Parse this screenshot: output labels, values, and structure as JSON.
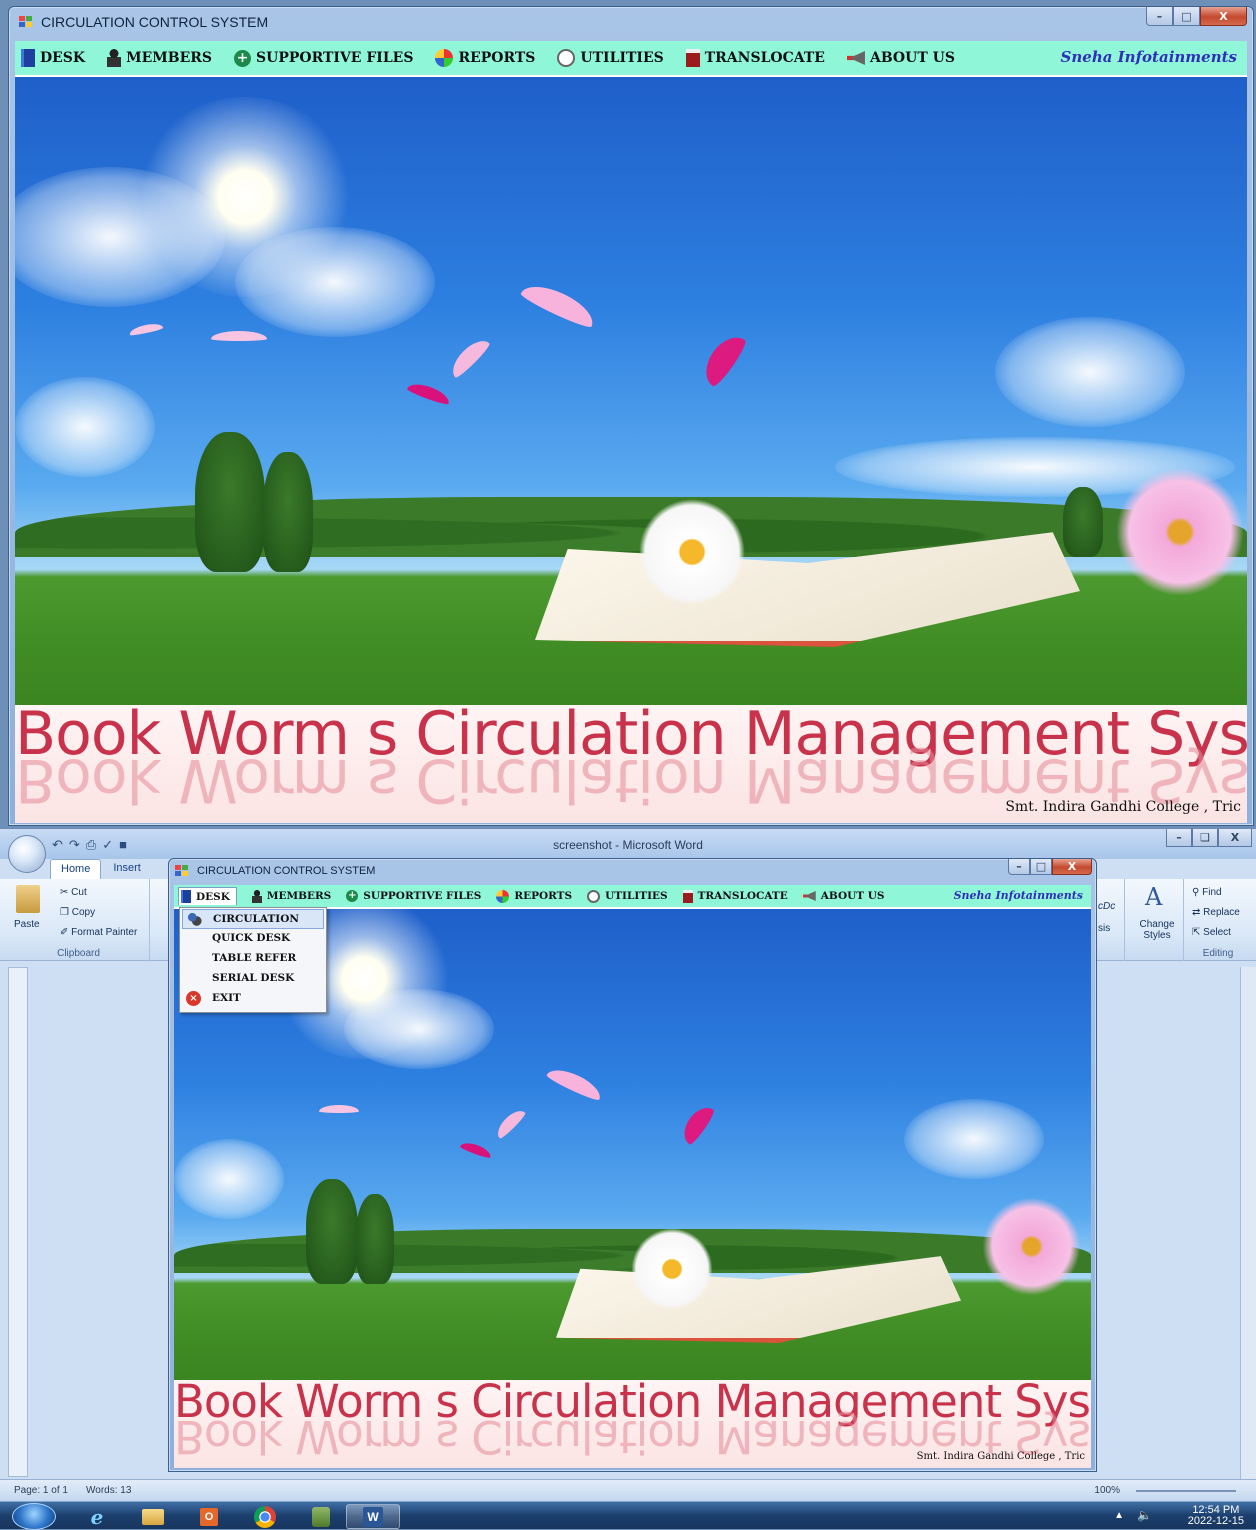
{
  "app_window": {
    "title": "CIRCULATION CONTROL SYSTEM",
    "controls": {
      "minimize": "–",
      "maximize": "□",
      "close": "X"
    },
    "menu": [
      {
        "key": "desk",
        "label": "DESK"
      },
      {
        "key": "members",
        "label": "MEMBERS"
      },
      {
        "key": "supportive",
        "label": "SUPPORTIVE FILES"
      },
      {
        "key": "reports",
        "label": "REPORTS"
      },
      {
        "key": "utilities",
        "label": "UTILITIES"
      },
      {
        "key": "translocate",
        "label": "TRANSLOCATE"
      },
      {
        "key": "about",
        "label": "ABOUT US"
      }
    ],
    "brand": "Sneha Infotainments",
    "banner_title": "Book Worm s Circulation Management System",
    "college": "Smt. Indira Gandhi College , Tric"
  },
  "word_window": {
    "title": "screenshot - Microsoft Word",
    "tabs": [
      "Home",
      "Insert"
    ],
    "clipboard": {
      "paste": "Paste",
      "cut": "Cut",
      "copy": "Copy",
      "format_painter": "Format Painter",
      "group_label": "Clipboard"
    },
    "styles": {
      "change_styles": "Change Styles",
      "partial_style_a": "cDc",
      "partial_style_b": "sis"
    },
    "editing": {
      "find": "Find",
      "replace": "Replace",
      "select": "Select",
      "group_label": "Editing"
    },
    "status": {
      "page": "Page: 1 of 1",
      "words": "Words: 13",
      "zoom": "100%"
    }
  },
  "desk_dropdown": {
    "items": [
      {
        "label": "CIRCULATION",
        "icon": "user-group-icon",
        "highlighted": true
      },
      {
        "label": "QUICK DESK",
        "icon": "",
        "highlighted": false
      },
      {
        "label": "TABLE REFER",
        "icon": "",
        "highlighted": false
      },
      {
        "label": "SERIAL DESK",
        "icon": "",
        "highlighted": false
      },
      {
        "label": "EXIT",
        "icon": "exit-icon",
        "highlighted": false
      }
    ]
  },
  "taskbar": {
    "time": "12:54 PM",
    "date": "2022-12-15",
    "apps": [
      "internet-explorer-icon",
      "file-explorer-icon",
      "outlook-icon",
      "chrome-icon",
      "installer-icon",
      "word-icon"
    ]
  },
  "colors": {
    "menubar": "#8ff7d7",
    "brand": "#2f2fb8",
    "banner_text": "#c8324a",
    "dropdown_highlight": "#d8e6f8"
  }
}
